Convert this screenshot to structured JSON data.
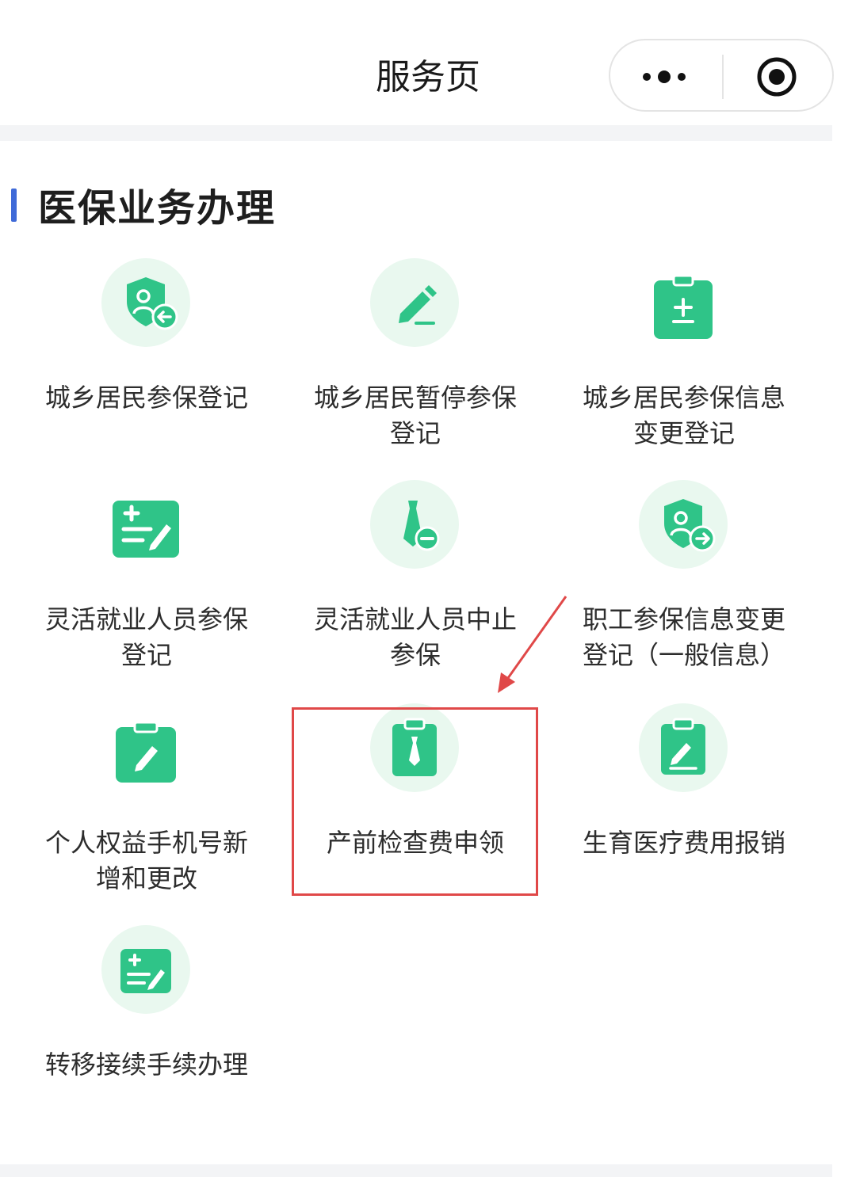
{
  "nav": {
    "title": "服务页"
  },
  "section": {
    "title": "医保业务办理"
  },
  "services": [
    {
      "label": "城乡居民参保登记",
      "icon": "shield-user-arrow-icon"
    },
    {
      "label": "城乡居民暂停参保登记",
      "icon": "pencil-icon"
    },
    {
      "label": "城乡居民参保信息变更登记",
      "icon": "clipboard-plus-minus-icon"
    },
    {
      "label": "灵活就业人员参保登记",
      "icon": "form-edit-icon"
    },
    {
      "label": "灵活就业人员中止参保",
      "icon": "tie-minus-icon"
    },
    {
      "label": "职工参保信息变更登记（一般信息）",
      "icon": "shield-user-forward-icon"
    },
    {
      "label": "个人权益手机号新增和更改",
      "icon": "clipboard-pencil-icon"
    },
    {
      "label": "产前检查费申领",
      "icon": "clipboard-tie-icon"
    },
    {
      "label": "生育医疗费用报销",
      "icon": "clipboard-edit-icon"
    },
    {
      "label": "转移接续手续办理",
      "icon": "form-edit-icon"
    }
  ],
  "colors": {
    "accent_bar": "#3f6ad8",
    "icon_green": "#2fc488",
    "icon_bg": "#e9f8ef",
    "annotation_red": "#e04848"
  }
}
